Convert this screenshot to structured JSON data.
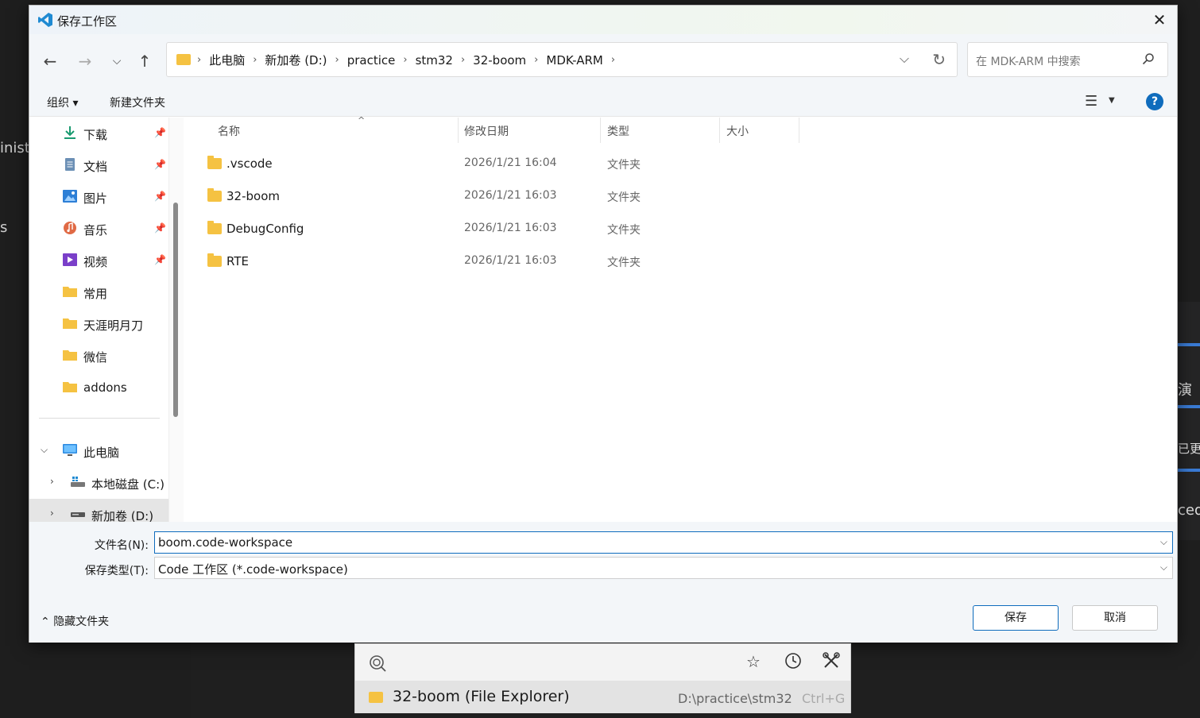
{
  "background": {
    "left_text_1": "inist",
    "left_text_2": "s",
    "right_text_1": "演",
    "right_text_2": "已更",
    "right_text_3": "ced"
  },
  "dialog": {
    "title": "保存工作区",
    "close_label": "✕"
  },
  "address": {
    "crumbs": [
      "此电脑",
      "新加卷 (D:)",
      "practice",
      "stm32",
      "32-boom",
      "MDK-ARM"
    ]
  },
  "search": {
    "placeholder": "在 MDK-ARM 中搜索"
  },
  "toolbar": {
    "organize": "组织 ▾",
    "new_folder": "新建文件夹",
    "help": "?"
  },
  "sidebar": {
    "quick_access": [
      {
        "label": "下载",
        "icon": "download-icon",
        "pinned": true
      },
      {
        "label": "文档",
        "icon": "document-icon",
        "pinned": true
      },
      {
        "label": "图片",
        "icon": "pictures-icon",
        "pinned": true
      },
      {
        "label": "音乐",
        "icon": "music-icon",
        "pinned": true
      },
      {
        "label": "视频",
        "icon": "video-icon",
        "pinned": true
      },
      {
        "label": "常用",
        "icon": "folder-icon",
        "pinned": false
      },
      {
        "label": "天涯明月刀",
        "icon": "folder-icon",
        "pinned": false
      },
      {
        "label": "微信",
        "icon": "folder-icon",
        "pinned": false
      },
      {
        "label": "addons",
        "icon": "folder-icon",
        "pinned": false
      }
    ],
    "this_pc": "此电脑",
    "drives": [
      {
        "label": "本地磁盘 (C:)"
      },
      {
        "label": "新加卷 (D:)"
      }
    ]
  },
  "columns": {
    "name": "名称",
    "modified": "修改日期",
    "type": "类型",
    "size": "大小"
  },
  "files": [
    {
      "name": ".vscode",
      "modified": "2026/1/21 16:04",
      "type": "文件夹"
    },
    {
      "name": "32-boom",
      "modified": "2026/1/21 16:03",
      "type": "文件夹"
    },
    {
      "name": "DebugConfig",
      "modified": "2026/1/21 16:03",
      "type": "文件夹"
    },
    {
      "name": "RTE",
      "modified": "2026/1/21 16:03",
      "type": "文件夹"
    }
  ],
  "form": {
    "filename_label": "文件名(N):",
    "filename_value": "boom.code-workspace",
    "filetype_label": "保存类型(T):",
    "filetype_value": "Code 工作区 (*.code-workspace)"
  },
  "footer": {
    "hide_folders": "隐藏文件夹",
    "save": "保存",
    "cancel": "取消"
  },
  "popup": {
    "result_label": "32-boom (File Explorer)",
    "result_path": "D:\\practice\\stm32",
    "shortcut": "Ctrl+G"
  },
  "colors": {
    "accent": "#0f6cbd",
    "folder": "#f5c242"
  }
}
